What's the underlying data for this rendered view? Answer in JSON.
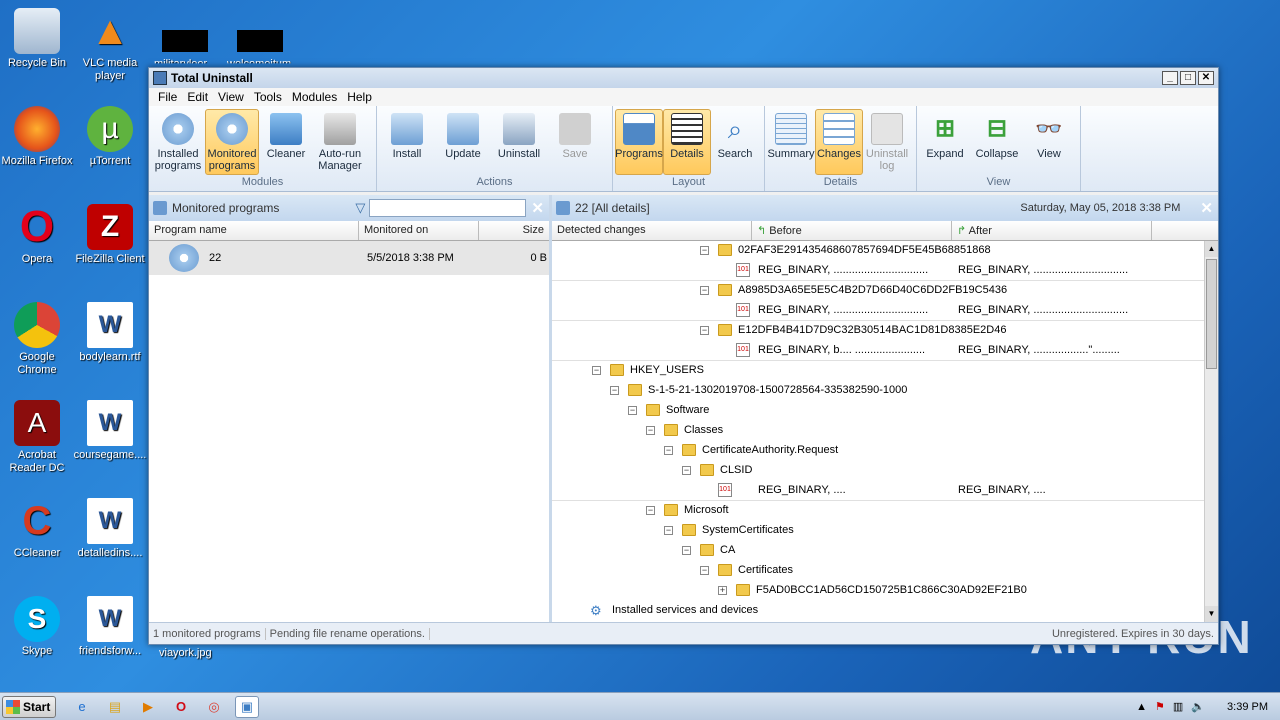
{
  "desktop": {
    "icons": [
      {
        "label": "Recycle Bin",
        "glyph": "🗑"
      },
      {
        "label": "VLC media player",
        "glyph": "▲"
      },
      {
        "label": "Mozilla Firefox",
        "glyph": "◉"
      },
      {
        "label": "µTorrent",
        "glyph": "µ"
      },
      {
        "label": "Opera",
        "glyph": "O"
      },
      {
        "label": "FileZilla Client",
        "glyph": "Z"
      },
      {
        "label": "Google Chrome",
        "glyph": "◎"
      },
      {
        "label": "bodylearn.rtf",
        "glyph": "W"
      },
      {
        "label": "Acrobat Reader DC",
        "glyph": "A"
      },
      {
        "label": "coursegame....",
        "glyph": "W"
      },
      {
        "label": "CCleaner",
        "glyph": "C"
      },
      {
        "label": "detalledins....",
        "glyph": "W"
      },
      {
        "label": "Skype",
        "glyph": "S"
      },
      {
        "label": "friendsforw...",
        "glyph": "W"
      }
    ],
    "obscured_label_1": "militaryleer",
    "obscured_label_2": "welcomeitum",
    "behind_label": "viayork.jpg"
  },
  "window": {
    "title": "Total Uninstall",
    "menu": [
      "File",
      "Edit",
      "View",
      "Tools",
      "Modules",
      "Help"
    ],
    "ribbon": {
      "modules": {
        "name": "Modules",
        "buttons": [
          "Installed programs",
          "Monitored programs",
          "Cleaner",
          "Auto-run Manager"
        ]
      },
      "actions": {
        "name": "Actions",
        "buttons": [
          "Install",
          "Update",
          "Uninstall",
          "Save"
        ]
      },
      "layout": {
        "name": "Layout",
        "buttons": [
          "Programs",
          "Details",
          "Search"
        ]
      },
      "details": {
        "name": "Details",
        "buttons": [
          "Summary",
          "Changes",
          "Uninstall log"
        ]
      },
      "view": {
        "name": "View",
        "buttons": [
          "Expand",
          "Collapse",
          "View"
        ]
      }
    },
    "left_pane": {
      "title": "Monitored programs",
      "columns": [
        "Program name",
        "Monitored on",
        "Size"
      ],
      "rows": [
        {
          "name": "22",
          "date": "5/5/2018 3:38 PM",
          "size": "0 B"
        }
      ]
    },
    "right_pane": {
      "title": "22 [All details]",
      "date": "Saturday, May 05, 2018 3:38 PM",
      "columns": [
        "Detected changes",
        "Before",
        "After"
      ],
      "tree": [
        {
          "type": "key",
          "name": "02FAF3E291435468607857694DF5E45B68851868"
        },
        {
          "type": "value",
          "before": "REG_BINARY, ...............................",
          "after": "REG_BINARY, ..............................."
        },
        {
          "type": "key",
          "name": "A8985D3A65E5E5C4B2D7D66D40C6DD2FB19C5436"
        },
        {
          "type": "value",
          "before": "REG_BINARY, ...............................",
          "after": "REG_BINARY, ..............................."
        },
        {
          "type": "key",
          "name": "E12DFB4B41D7D9C32B30514BAC1D81D8385E2D46"
        },
        {
          "type": "value",
          "before": "REG_BINARY, b.... .......................",
          "after": "REG_BINARY, ..................\"........."
        },
        {
          "type": "key",
          "name": "HKEY_USERS"
        },
        {
          "type": "key",
          "name": "S-1-5-21-1302019708-1500728564-335382590-1000"
        },
        {
          "type": "key",
          "name": "Software"
        },
        {
          "type": "key",
          "name": "Classes"
        },
        {
          "type": "key",
          "name": "CertificateAuthority.Request"
        },
        {
          "type": "key",
          "name": "CLSID"
        },
        {
          "type": "value",
          "before": "REG_BINARY, ....",
          "after": "REG_BINARY, ...."
        },
        {
          "type": "key",
          "name": "Microsoft"
        },
        {
          "type": "key",
          "name": "SystemCertificates"
        },
        {
          "type": "key",
          "name": "CA"
        },
        {
          "type": "key",
          "name": "Certificates"
        },
        {
          "type": "key",
          "name": "F5AD0BCC1AD56CD150725B1C866C30AD92EF21B0"
        },
        {
          "type": "service",
          "name": "Installed services and devices"
        }
      ]
    },
    "status": {
      "count": "1 monitored programs",
      "message": "Pending file rename operations.",
      "registration": "Unregistered. Expires in 30 days."
    }
  },
  "taskbar": {
    "start_label": "Start",
    "time": "3:39 PM"
  },
  "watermark": "ANY RUN"
}
